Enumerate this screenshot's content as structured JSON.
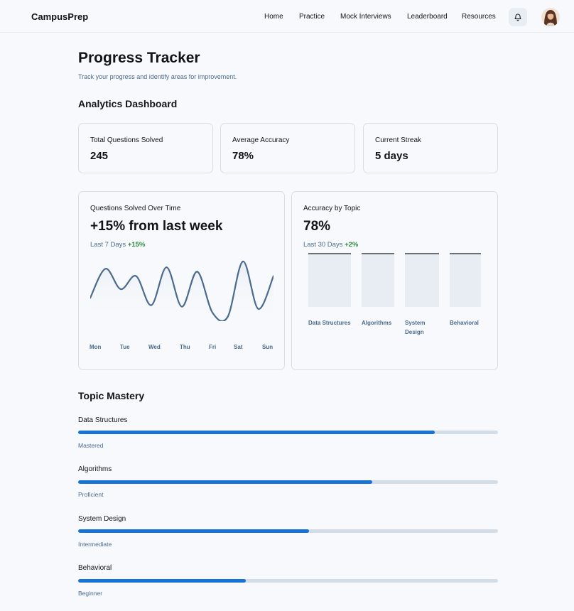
{
  "header": {
    "logo": "CampusPrep",
    "nav": [
      {
        "label": "Home"
      },
      {
        "label": "Practice"
      },
      {
        "label": "Mock Interviews"
      },
      {
        "label": "Leaderboard"
      },
      {
        "label": "Resources"
      }
    ],
    "icons": {
      "notifications": "bell-icon",
      "profile": "avatar"
    }
  },
  "page": {
    "title": "Progress Tracker",
    "subtitle": "Track your progress and identify areas for improvement."
  },
  "analytics": {
    "title": "Analytics Dashboard",
    "stats": [
      {
        "label": "Total Questions Solved",
        "value": "245"
      },
      {
        "label": "Average Accuracy",
        "value": "78%"
      },
      {
        "label": "Current Streak",
        "value": "5 days"
      }
    ]
  },
  "questions_chart": {
    "label": "Questions Solved Over Time",
    "headline": "+15% from last week",
    "period": "Last 7 Days",
    "change": "+15%",
    "line_color": "#4a6b8e"
  },
  "accuracy_chart": {
    "label": "Accuracy by Topic",
    "headline": "78%",
    "period": "Last 30 Days",
    "change": "+2%"
  },
  "chart_data": [
    {
      "type": "line",
      "x": [
        "Mon",
        "Tue",
        "Wed",
        "Thu",
        "Fri",
        "Sat",
        "Sun"
      ],
      "series": [
        {
          "values": [
            50,
            90,
            62,
            80,
            40,
            92,
            38,
            86,
            30,
            24,
            100,
            35,
            80
          ]
        }
      ],
      "xlabel": "",
      "ylabel": "",
      "grid": false
    },
    {
      "type": "bar",
      "categories": [
        "Data Structures",
        "Algorithms",
        "System Design",
        "Behavioral"
      ],
      "values": [
        100,
        100,
        100,
        100
      ],
      "xlabel": "",
      "ylabel": ""
    }
  ],
  "mastery": {
    "title": "Topic Mastery",
    "accent": "#1774d4",
    "track": "#d3dde8",
    "items": [
      {
        "name": "Data Structures",
        "level": "Mastered",
        "progress": 0.85
      },
      {
        "name": "Algorithms",
        "level": "Proficient",
        "progress": 0.7
      },
      {
        "name": "System Design",
        "level": "Intermediate",
        "progress": 0.55
      },
      {
        "name": "Behavioral",
        "level": "Beginner",
        "progress": 0.4
      }
    ]
  }
}
